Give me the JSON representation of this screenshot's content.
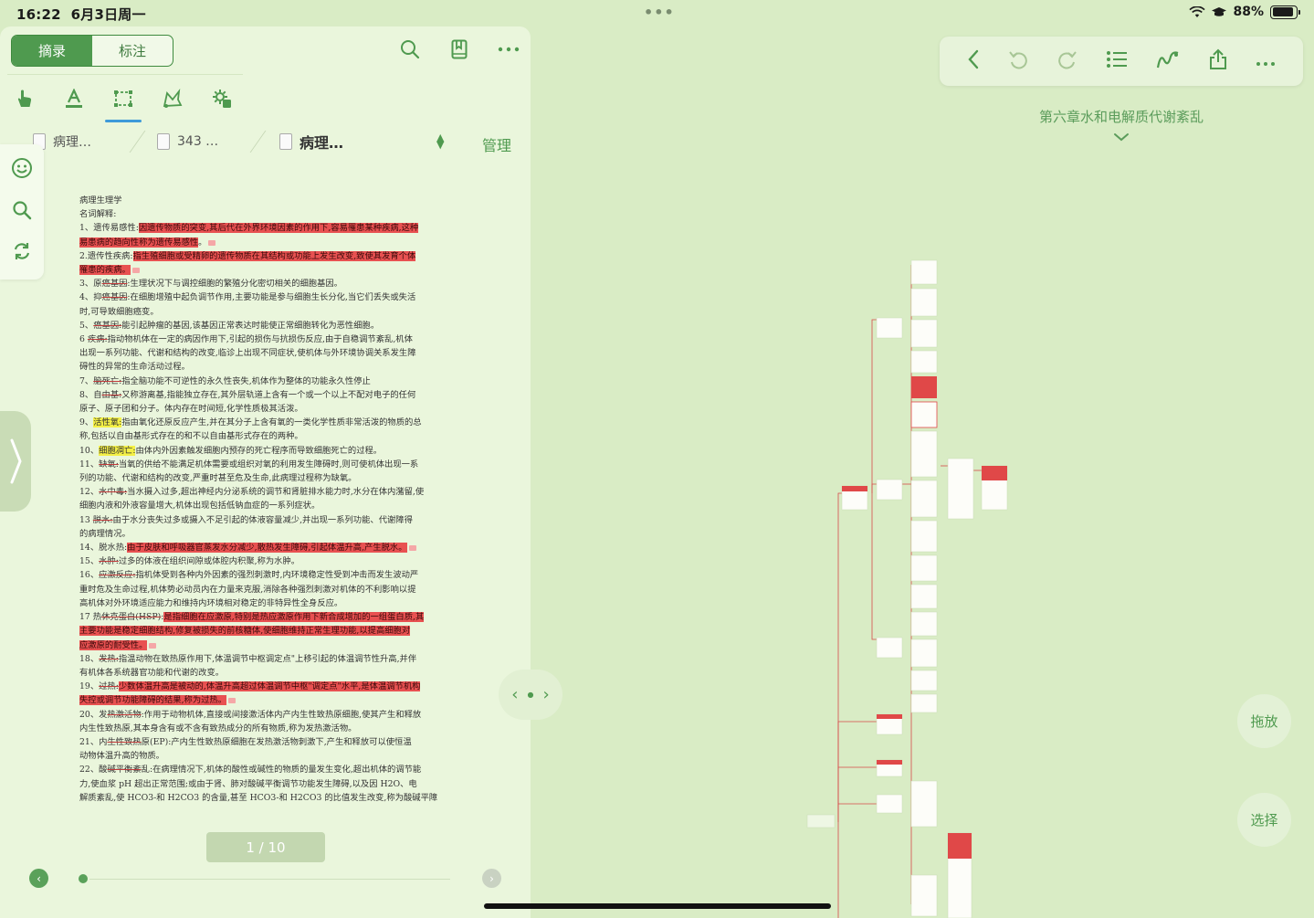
{
  "status": {
    "time": "16:22",
    "date": "6月3日周一",
    "battery": "88%",
    "battery_level": 0.88
  },
  "left": {
    "segments": [
      "摘录",
      "标注"
    ],
    "tabs": [
      "病理…",
      "343 …",
      "病理…"
    ],
    "manage": "管理",
    "page_indicator": "1 / 10",
    "doc": {
      "lines": [
        [
          {
            "t": "病理生理学"
          }
        ],
        [
          {
            "t": "名词解释:"
          }
        ],
        [
          {
            "t": "1、遗传易感性:"
          },
          {
            "t": "因遗传物质的突变,其后代在外界环境因素的作用下,容易罹患某种疾病,这种",
            "c": "hl"
          }
        ],
        [
          {
            "t": "易患病的趋向性称为遗传易感性",
            "c": "hl"
          },
          {
            "t": "。"
          },
          {
            "n": 1
          }
        ],
        [
          {
            "t": "2.遗传性疾病:"
          },
          {
            "t": "指生殖细胞或受精卵的遗传物质在其结构或功能上发生改变,致使其发育个体",
            "c": "hl"
          }
        ],
        [
          {
            "t": "罹患的疾病。",
            "c": "hl"
          },
          {
            "n": 1
          }
        ],
        [
          {
            "t": "3、原"
          },
          {
            "t": "癌基因",
            "c": "strike"
          },
          {
            "t": ":生理状况下与调控细胞的繁殖分化密切相关的细胞基因。"
          }
        ],
        [
          {
            "t": "4、抑"
          },
          {
            "t": "癌基因",
            "c": "strike"
          },
          {
            "t": ":在细胞增殖中起负调节作用,主要功能是参与细胞生长分化,当它们丢失或失活"
          }
        ],
        [
          {
            "t": "时,可导致细胞癌变。"
          }
        ],
        [
          {
            "t": "5、"
          },
          {
            "t": "癌基因:",
            "c": "strike"
          },
          {
            "t": "能引起肿瘤的基因,该基因正常表达时能使正常细胞转化为恶性细胞。"
          }
        ],
        [
          {
            "t": "6  "
          },
          {
            "t": "疾病:",
            "c": "strike"
          },
          {
            "t": "指动物机体在一定的病因作用下,引起的损伤与抗损伤反应,由于自稳调节紊乱,机体"
          }
        ],
        [
          {
            "t": "出现一系列功能、代谢和结构的改变,临诊上出现不同症状,使机体与外环境协调关系发生障"
          }
        ],
        [
          {
            "t": "碍性的异常的生命活动过程。"
          }
        ],
        [
          {
            "t": "7、"
          },
          {
            "t": "脑死亡:",
            "c": "strike"
          },
          {
            "t": "指全脑功能不可逆性的永久性丧失,机体作为整体的功能永久性停止"
          }
        ],
        [
          {
            "t": "8、自"
          },
          {
            "t": "由基:",
            "c": "strike"
          },
          {
            "t": "又称游离基,指能独立存在,其外层轨道上含有一个或一个以上不配对电子的任何"
          }
        ],
        [
          {
            "t": "原子、原子团和分子。体内存在时间短,化学性质极其活泼。"
          }
        ],
        [
          {
            "t": "9、"
          },
          {
            "t": "活性氧:",
            "c": "hly"
          },
          {
            "t": "指由氧化还原反应产生,并在其分子上含有氧的一类化学性质非常活泼的物质的总"
          }
        ],
        [
          {
            "t": "称,包括以自由基形式存在的和不以自由基形式存在的两种。"
          }
        ],
        [
          {
            "t": "10、"
          },
          {
            "t": "细胞凋亡:",
            "c": "hly"
          },
          {
            "t": "由体内外因素触发细胞内预存的死亡程序而导致细胞死亡的过程。"
          }
        ],
        [
          {
            "t": "11、"
          },
          {
            "t": "缺氧:",
            "c": "strike"
          },
          {
            "t": "当氧的供给不能满足机体需要或组织对氧的利用发生障碍时,则可使机体出现一系"
          }
        ],
        [
          {
            "t": "列的功能、代谢和结构的改变,严重时甚至危及生命,此病理过程称为缺氧。"
          }
        ],
        [
          {
            "t": "12、"
          },
          {
            "t": "水中毒:",
            "c": "strike"
          },
          {
            "t": "当水摄入过多,超出神经内分泌系统的调节和肾脏排水能力时,水分在体内潴留,使"
          }
        ],
        [
          {
            "t": "细胞内液和外液容量增大,机体出现包括低钠血症的一系列症状。"
          }
        ],
        [
          {
            "t": "13  "
          },
          {
            "t": "脱水:",
            "c": "strike"
          },
          {
            "t": "由于水分丧失过多或摄入不足引起的体液容量减少,并出现一系列功能、代谢障得"
          }
        ],
        [
          {
            "t": "的病理情况。"
          }
        ],
        [
          {
            "t": "14、脱水热:"
          },
          {
            "t": "由于皮肤和呼吸器官蒸发水分减少,散热发生障碍,引起体温升高,产生脱水。",
            "c": "hl"
          },
          {
            "n": 1
          }
        ],
        [
          {
            "t": "15、"
          },
          {
            "t": "水肿:",
            "c": "strike"
          },
          {
            "t": "过多的体液在组织间隙或体腔内积聚,称为水肿。"
          }
        ],
        [
          {
            "t": "16、"
          },
          {
            "t": "应激反应:",
            "c": "strike"
          },
          {
            "t": "指机体受到各种内外因素的强烈刺激时,内环境稳定性受到冲击而发生波动严"
          }
        ],
        [
          {
            "t": "重时危及生命过程,机体势必动员内在力量来克服,消除各种强烈刺激对机体的不利影响以提"
          }
        ],
        [
          {
            "t": "高机体对外环境适应能力和维持内环境相对稳定的非特异性全身反应。"
          }
        ],
        [
          {
            "t": "17  热"
          },
          {
            "t": "休克蛋白(HSP)",
            "c": "strike"
          },
          {
            "t": ":"
          },
          {
            "t": "是指细胞在应激原,特别是热应激原作用下新合成增加的一组蛋白质,其",
            "c": "hl"
          }
        ],
        [
          {
            "t": "主要功能是稳定细胞结构,修复被损失的前核糖体,使细胞维持正常生理功能,以提高细胞对",
            "c": "hl"
          }
        ],
        [
          {
            "t": "应激原的耐受性。",
            "c": "hl"
          },
          {
            "n": 1
          }
        ],
        [
          {
            "t": "18、"
          },
          {
            "t": "发热:",
            "c": "strike"
          },
          {
            "t": "指温动物在致热原作用下,体温调节中枢调定点\"上移引起的体温调节性升高,并伴"
          }
        ],
        [
          {
            "t": "有机体各系统器官功能和代谢的改变。"
          }
        ],
        [
          {
            "t": "19、"
          },
          {
            "t": "过热:",
            "c": "strike"
          },
          {
            "t": "少数体温升高是被动的,体温升高超过体温调节中枢\"调定点\"水平,是体温调节机构",
            "c": "hl"
          }
        ],
        [
          {
            "t": "失控或调节功能障碍的结果,称为过热。",
            "c": "hl"
          },
          {
            "n": 1
          }
        ],
        [
          {
            "t": "20、发"
          },
          {
            "t": "热激活物",
            "c": "strike"
          },
          {
            "t": ":作用于动物机体,直接或间接激活体内产内生性致热原细胞,使其产生和释放"
          }
        ],
        [
          {
            "t": "内生性致热原,其本身含有或不含有致热成分的所有物质,称为发热激活物。"
          }
        ],
        [
          {
            "t": "21、内"
          },
          {
            "t": "生性致热",
            "c": "strike"
          },
          {
            "t": "原(EP):产内生性致热原细胞在发热激活物刺激下,产生和释放可以使恒温"
          }
        ],
        [
          {
            "t": "动物体温升高的物质。"
          }
        ],
        [
          {
            "t": "22、酸"
          },
          {
            "t": "碱平衡紊",
            "c": "strike"
          },
          {
            "t": "乱:在病理情况下,机体的酸性或碱性的物质的量发生变化,超出机体的调节能"
          }
        ],
        [
          {
            "t": "力,使血浆 pH 超出正常范围;或由于肾、肺对酸碱平衡调节功能发生障碍,以及因 H2O、电"
          }
        ],
        [
          {
            "t": "解质紊乱,使 HCO3-和 H2CO3 的含量,甚至 HCO3-和 H2CO3 的比值发生改变,称为酸碱平障"
          }
        ]
      ]
    }
  },
  "right": {
    "map_title": "第六章水和电解质代谢紊乱",
    "buttons": {
      "drag": "拖放",
      "select": "选择"
    }
  },
  "colors": {
    "accent": "#4f9a4f",
    "highlight": "#e85151",
    "yellow": "#f4f046",
    "background": "#d9ecc5"
  }
}
